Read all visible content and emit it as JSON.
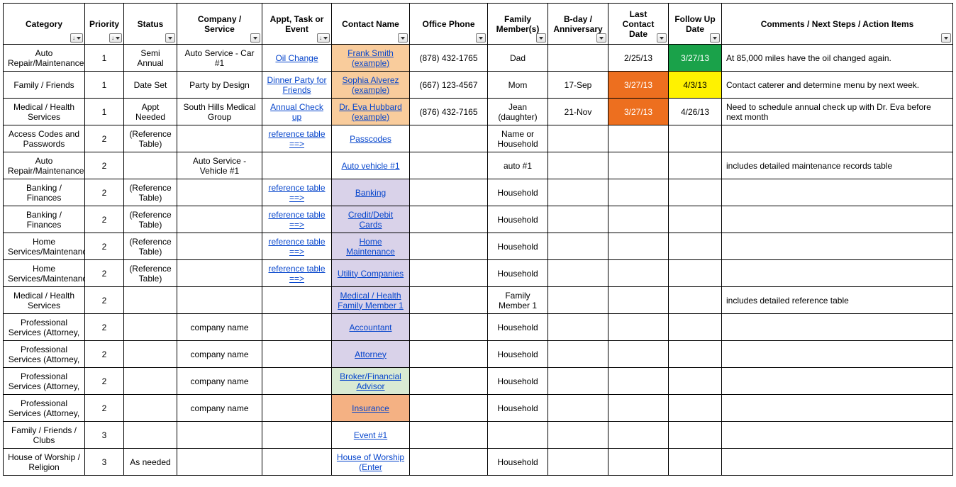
{
  "headers": {
    "category": "Category",
    "priority": "Priority",
    "status": "Status",
    "company": "Company / Service",
    "appt": "Appt, Task or Event",
    "contact": "Contact Name",
    "phone": "Office Phone",
    "family": "Family Member(s)",
    "bday": "B-day / Anniversary",
    "last": "Last Contact Date",
    "follow": "Follow Up Date",
    "comments": "Comments / Next Steps / Action Items"
  },
  "rows": [
    {
      "category": "Auto Repair/Maintenance",
      "priority": "1",
      "status": "Semi Annual",
      "company": "Auto Service - Car #1",
      "appt": {
        "text": "Oil Change",
        "link": true
      },
      "contact": {
        "text": "Frank Smith (example)",
        "link": true,
        "bg": "bg-orange-lt"
      },
      "phone": "(878) 432-1765",
      "family": "Dad",
      "bday": "",
      "last": {
        "text": "2/25/13"
      },
      "follow": {
        "text": "3/27/13",
        "bg": "bg-green"
      },
      "comments": "At 85,000 miles have the oil changed again."
    },
    {
      "category": "Family / Friends",
      "priority": "1",
      "status": "Date Set",
      "company": "Party by Design",
      "appt": {
        "text": "Dinner Party for Friends",
        "link": true
      },
      "contact": {
        "text": "Sophia Alverez (example)",
        "link": true,
        "bg": "bg-orange-lt"
      },
      "phone": "(667) 123-4567",
      "family": "Mom",
      "bday": "17-Sep",
      "last": {
        "text": "3/27/13",
        "bg": "bg-orange"
      },
      "follow": {
        "text": "4/3/13",
        "bg": "bg-yellow"
      },
      "comments": "Contact caterer and determine menu by next week."
    },
    {
      "category": "Medical / Health Services",
      "priority": "1",
      "status": "Appt Needed",
      "company": "South Hills Medical Group",
      "appt": {
        "text": "Annual Check up",
        "link": true
      },
      "contact": {
        "text": "Dr. Eva Hubbard (example)",
        "link": true,
        "bg": "bg-orange-lt"
      },
      "phone": "(876) 432-7165",
      "family": "Jean (daughter)",
      "bday": "21-Nov",
      "last": {
        "text": "3/27/13",
        "bg": "bg-orange"
      },
      "follow": {
        "text": "4/26/13"
      },
      "comments": "Need to schedule annual check up with Dr. Eva before next month"
    },
    {
      "category": "Access Codes and Passwords",
      "priority": "2",
      "status": "(Reference Table)",
      "company": "",
      "appt": {
        "text": "reference table ==>",
        "link": true
      },
      "contact": {
        "text": "Passcodes",
        "link": true,
        "bg": ""
      },
      "phone": "",
      "family": "Name or Household",
      "bday": "",
      "last": {
        "text": ""
      },
      "follow": {
        "text": ""
      },
      "comments": ""
    },
    {
      "category": "Auto Repair/Maintenance",
      "priority": "2",
      "status": "",
      "company": "Auto Service - Vehicle #1",
      "appt": {
        "text": "",
        "link": false
      },
      "contact": {
        "text": "Auto vehicle #1",
        "link": true,
        "bg": ""
      },
      "phone": "",
      "family": "auto #1",
      "bday": "",
      "last": {
        "text": ""
      },
      "follow": {
        "text": ""
      },
      "comments": "includes detailed maintenance records table"
    },
    {
      "category": "Banking / Finances",
      "priority": "2",
      "status": "(Reference Table)",
      "company": "",
      "appt": {
        "text": "reference table ==>",
        "link": true
      },
      "contact": {
        "text": "Banking",
        "link": true,
        "bg": "bg-lav"
      },
      "phone": "",
      "family": "Household",
      "bday": "",
      "last": {
        "text": ""
      },
      "follow": {
        "text": ""
      },
      "comments": ""
    },
    {
      "category": "Banking / Finances",
      "priority": "2",
      "status": "(Reference Table)",
      "company": "",
      "appt": {
        "text": "reference table ==>",
        "link": true
      },
      "contact": {
        "text": "Credit/Debit Cards",
        "link": true,
        "bg": "bg-lav"
      },
      "phone": "",
      "family": "Household",
      "bday": "",
      "last": {
        "text": ""
      },
      "follow": {
        "text": ""
      },
      "comments": ""
    },
    {
      "category": "Home Services/Maintenance",
      "priority": "2",
      "status": "(Reference Table)",
      "company": "",
      "appt": {
        "text": "reference table ==>",
        "link": true
      },
      "contact": {
        "text": "Home Maintenance",
        "link": true,
        "bg": "bg-lav"
      },
      "phone": "",
      "family": "Household",
      "bday": "",
      "last": {
        "text": ""
      },
      "follow": {
        "text": ""
      },
      "comments": ""
    },
    {
      "category": "Home Services/Maintenance",
      "priority": "2",
      "status": "(Reference Table)",
      "company": "",
      "appt": {
        "text": "reference table ==>",
        "link": true
      },
      "contact": {
        "text": "Utility Companies",
        "link": true,
        "bg": "bg-lav"
      },
      "phone": "",
      "family": "Household",
      "bday": "",
      "last": {
        "text": ""
      },
      "follow": {
        "text": ""
      },
      "comments": ""
    },
    {
      "category": "Medical / Health Services",
      "priority": "2",
      "status": "",
      "company": "",
      "appt": {
        "text": "",
        "link": false
      },
      "contact": {
        "text": "Medical / Health Family Member 1",
        "link": true,
        "bg": "bg-lav"
      },
      "phone": "",
      "family": "Family Member 1",
      "bday": "",
      "last": {
        "text": ""
      },
      "follow": {
        "text": ""
      },
      "comments": "includes detailed reference table"
    },
    {
      "category": "Professional Services (Attorney,",
      "priority": "2",
      "status": "",
      "company": "company name",
      "appt": {
        "text": "",
        "link": false
      },
      "contact": {
        "text": "Accountant",
        "link": true,
        "bg": "bg-lav"
      },
      "phone": "",
      "family": "Household",
      "bday": "",
      "last": {
        "text": ""
      },
      "follow": {
        "text": ""
      },
      "comments": ""
    },
    {
      "category": "Professional Services (Attorney,",
      "priority": "2",
      "status": "",
      "company": "company name",
      "appt": {
        "text": "",
        "link": false
      },
      "contact": {
        "text": "Attorney",
        "link": true,
        "bg": "bg-lav"
      },
      "phone": "",
      "family": "Household",
      "bday": "",
      "last": {
        "text": ""
      },
      "follow": {
        "text": ""
      },
      "comments": ""
    },
    {
      "category": "Professional Services (Attorney,",
      "priority": "2",
      "status": "",
      "company": "company name",
      "appt": {
        "text": "",
        "link": false
      },
      "contact": {
        "text": "Broker/Financial Advisor",
        "link": true,
        "bg": "bg-green-lt"
      },
      "phone": "",
      "family": "Household",
      "bday": "",
      "last": {
        "text": ""
      },
      "follow": {
        "text": ""
      },
      "comments": ""
    },
    {
      "category": "Professional Services (Attorney,",
      "priority": "2",
      "status": "",
      "company": "company name",
      "appt": {
        "text": "",
        "link": false
      },
      "contact": {
        "text": "Insurance",
        "link": true,
        "bg": "bg-peach"
      },
      "phone": "",
      "family": "Household",
      "bday": "",
      "last": {
        "text": ""
      },
      "follow": {
        "text": ""
      },
      "comments": ""
    },
    {
      "category": "Family / Friends / Clubs",
      "priority": "3",
      "status": "",
      "company": "",
      "appt": {
        "text": "",
        "link": false
      },
      "contact": {
        "text": "Event #1",
        "link": true,
        "bg": ""
      },
      "phone": "",
      "family": "",
      "bday": "",
      "last": {
        "text": ""
      },
      "follow": {
        "text": ""
      },
      "comments": ""
    },
    {
      "category": "House of Worship / Religion",
      "priority": "3",
      "status": "As needed",
      "company": "",
      "appt": {
        "text": "",
        "link": false
      },
      "contact": {
        "text": "House of Worship (Enter",
        "link": true,
        "bg": ""
      },
      "phone": "",
      "family": "Household",
      "bday": "",
      "last": {
        "text": ""
      },
      "follow": {
        "text": ""
      },
      "comments": ""
    }
  ]
}
